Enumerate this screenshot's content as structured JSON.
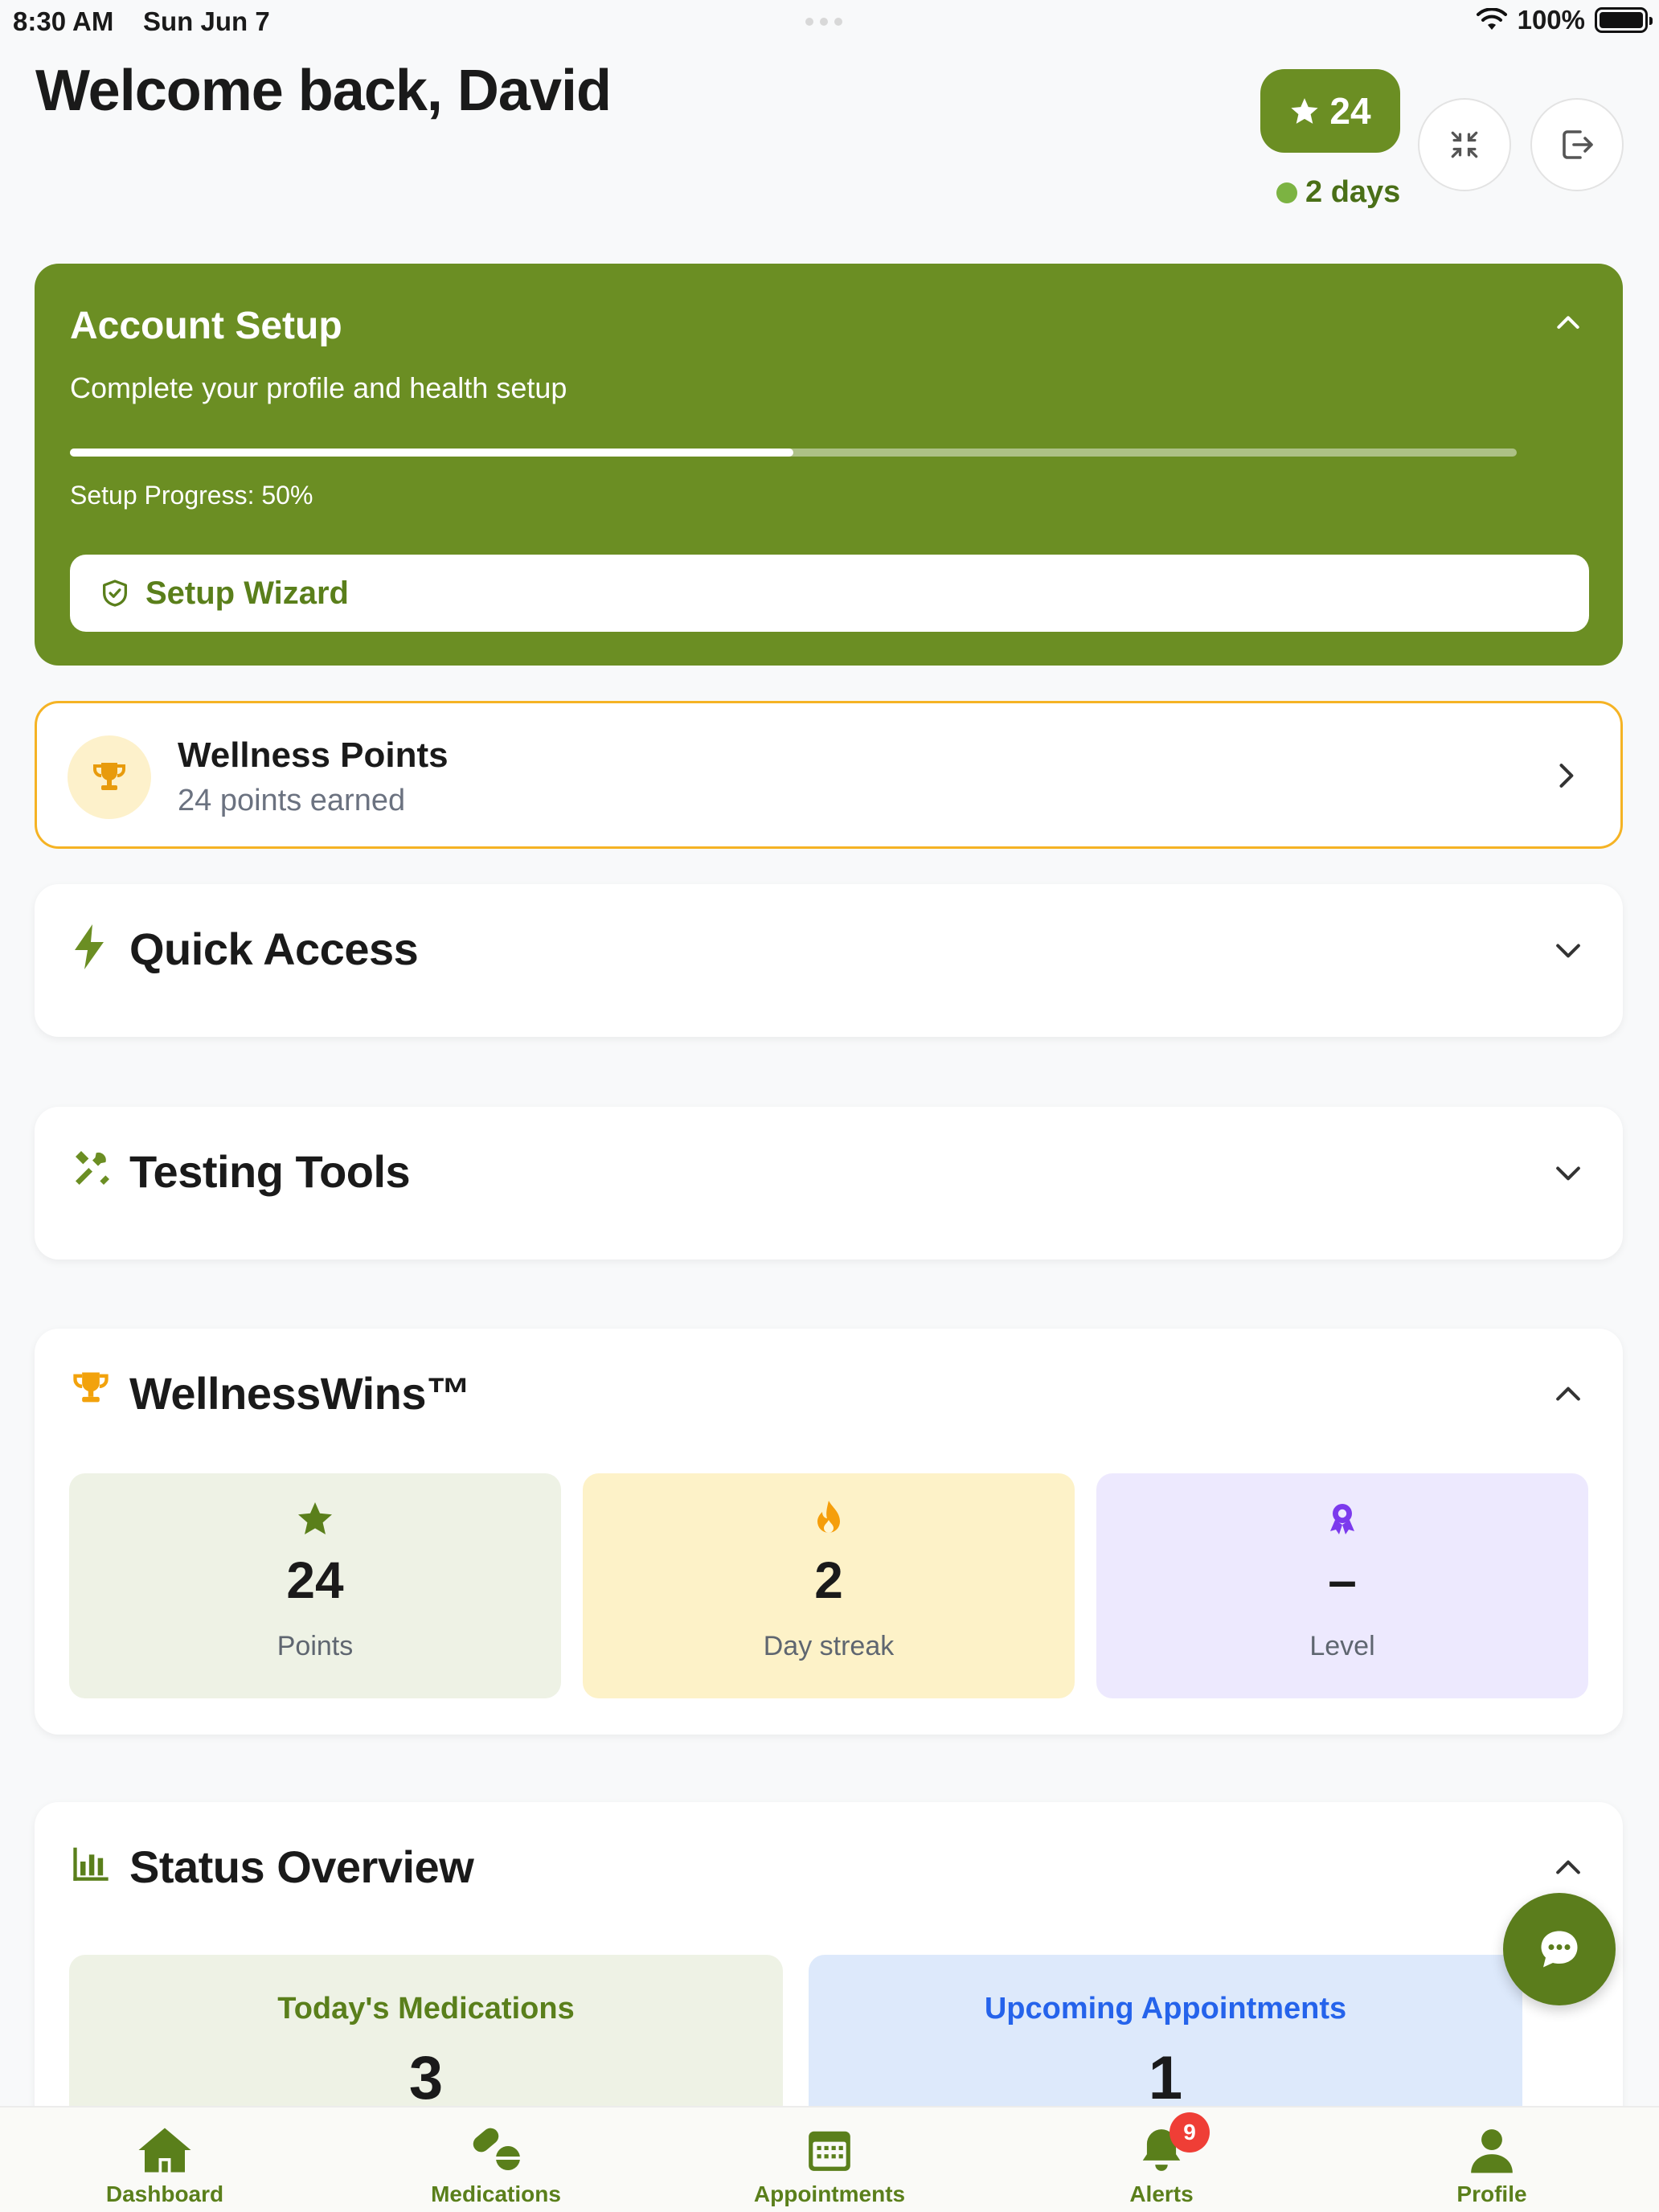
{
  "status_bar": {
    "time": "8:30 AM",
    "date": "Sun Jun 7",
    "battery": "100%"
  },
  "header": {
    "title": "Welcome back, David",
    "points": "24",
    "streak": "2 days"
  },
  "account_setup": {
    "title": "Account Setup",
    "subtitle": "Complete your profile and health setup",
    "progress_label": "Setup Progress: 50%",
    "progress_value": 0.5,
    "wizard_label": "Setup Wizard"
  },
  "wellness_points": {
    "title": "Wellness Points",
    "subtitle": "24 points earned"
  },
  "sections": {
    "quick_access": "Quick Access",
    "testing_tools": "Testing Tools",
    "wellness_wins": "WellnessWins™",
    "status_overview": "Status Overview"
  },
  "wellness_wins": {
    "stats": [
      {
        "value": "24",
        "label": "Points",
        "icon": "star-icon",
        "color": "#eef2e5"
      },
      {
        "value": "2",
        "label": "Day streak",
        "icon": "flame-icon",
        "color": "#fdf2c8"
      },
      {
        "value": "–",
        "label": "Level",
        "icon": "award-icon",
        "color": "#ede9fe"
      }
    ]
  },
  "status_overview": {
    "tiles": [
      {
        "label": "Today's Medications",
        "value": "3",
        "color": "#eef2e5",
        "label_color": "#5a7f1b"
      },
      {
        "label": "Upcoming Appointments",
        "value": "1",
        "color": "#dde9fb",
        "label_color": "#2563eb"
      }
    ]
  },
  "tabs": [
    {
      "label": "Dashboard",
      "icon": "home-icon"
    },
    {
      "label": "Medications",
      "icon": "pills-icon"
    },
    {
      "label": "Appointments",
      "icon": "calendar-icon"
    },
    {
      "label": "Alerts",
      "icon": "bell-icon",
      "badge": "9"
    },
    {
      "label": "Profile",
      "icon": "user-icon"
    }
  ],
  "colors": {
    "brand": "#6b8e23",
    "accent_amber": "#f5b324",
    "badge_red": "#ef3e36"
  }
}
